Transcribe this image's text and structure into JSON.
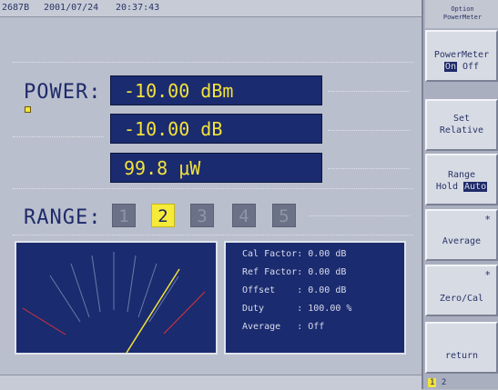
{
  "header": {
    "model": "2687B",
    "date": "2001/07/24",
    "time": "20:37:43"
  },
  "power": {
    "label": "POWER:",
    "readings": [
      "-10.00 dBm",
      "-10.00 dB",
      "99.8 μW"
    ]
  },
  "range": {
    "label": "RANGE:",
    "items": [
      "1",
      "2",
      "3",
      "4",
      "5"
    ],
    "selected": "2"
  },
  "info": {
    "rows": [
      "Cal Factor: 0.00 dB",
      "Ref Factor: 0.00 dB",
      "Offset    : 0.00 dB",
      "Duty      : 100.00 %",
      "Average   : Off"
    ]
  },
  "softkeys": {
    "header_line1": "Option",
    "header_line2": "PowerMeter",
    "powermeter": {
      "label": "PowerMeter",
      "on": "On",
      "off": "Off"
    },
    "set_relative": {
      "line1": "Set",
      "line2": "Relative"
    },
    "range_mode": {
      "line1": "Range",
      "hold": "Hold",
      "auto": "Auto"
    },
    "average": {
      "label": "Average",
      "mark": "*"
    },
    "zero_cal": {
      "label": "Zero/Cal",
      "mark": "*"
    },
    "return": {
      "label": "return"
    }
  },
  "page_indicator": {
    "current": "1",
    "next": "2"
  },
  "colors": {
    "panel": "#1b2b6f",
    "readout": "#f3e33b",
    "background": "#b9bfcc"
  }
}
